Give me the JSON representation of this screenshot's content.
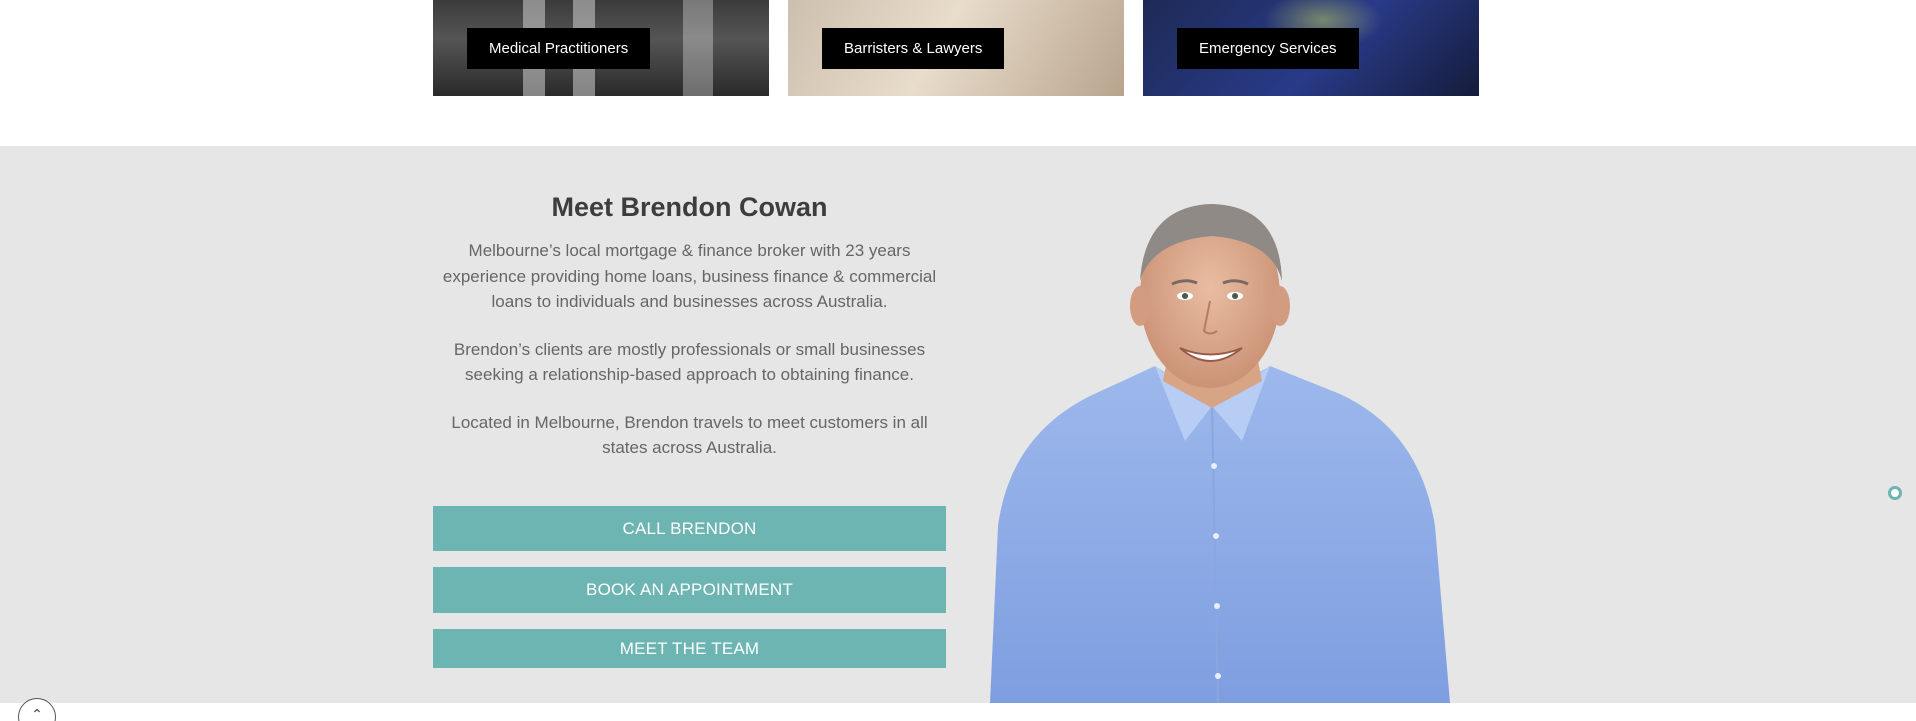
{
  "cards": [
    {
      "label": "Medical Practitioners"
    },
    {
      "label": "Barristers & Lawyers"
    },
    {
      "label": "Emergency Services"
    }
  ],
  "meet": {
    "title": "Meet Brendon Cowan",
    "paragraphs": [
      "Melbourne’s local mortgage & finance broker with 23 years experience providing home loans, business finance & commercial loans to individuals and businesses across Australia.",
      "Brendon’s clients are mostly professionals or small businesses seeking a relationship-based approach to obtaining finance.",
      "Located in Melbourne, Brendon travels to meet customers in all states across Australia."
    ],
    "buttons": {
      "call": "CALL BRENDON",
      "book": "BOOK AN APPOINTMENT",
      "team": "MEET THE TEAM"
    }
  },
  "scroll_top": {
    "icon": "chevron-up-icon",
    "glyph": "⌃"
  },
  "colors": {
    "accent": "#6cb5b2",
    "section_bg": "#e6e6e6",
    "label_bg": "#000000"
  }
}
